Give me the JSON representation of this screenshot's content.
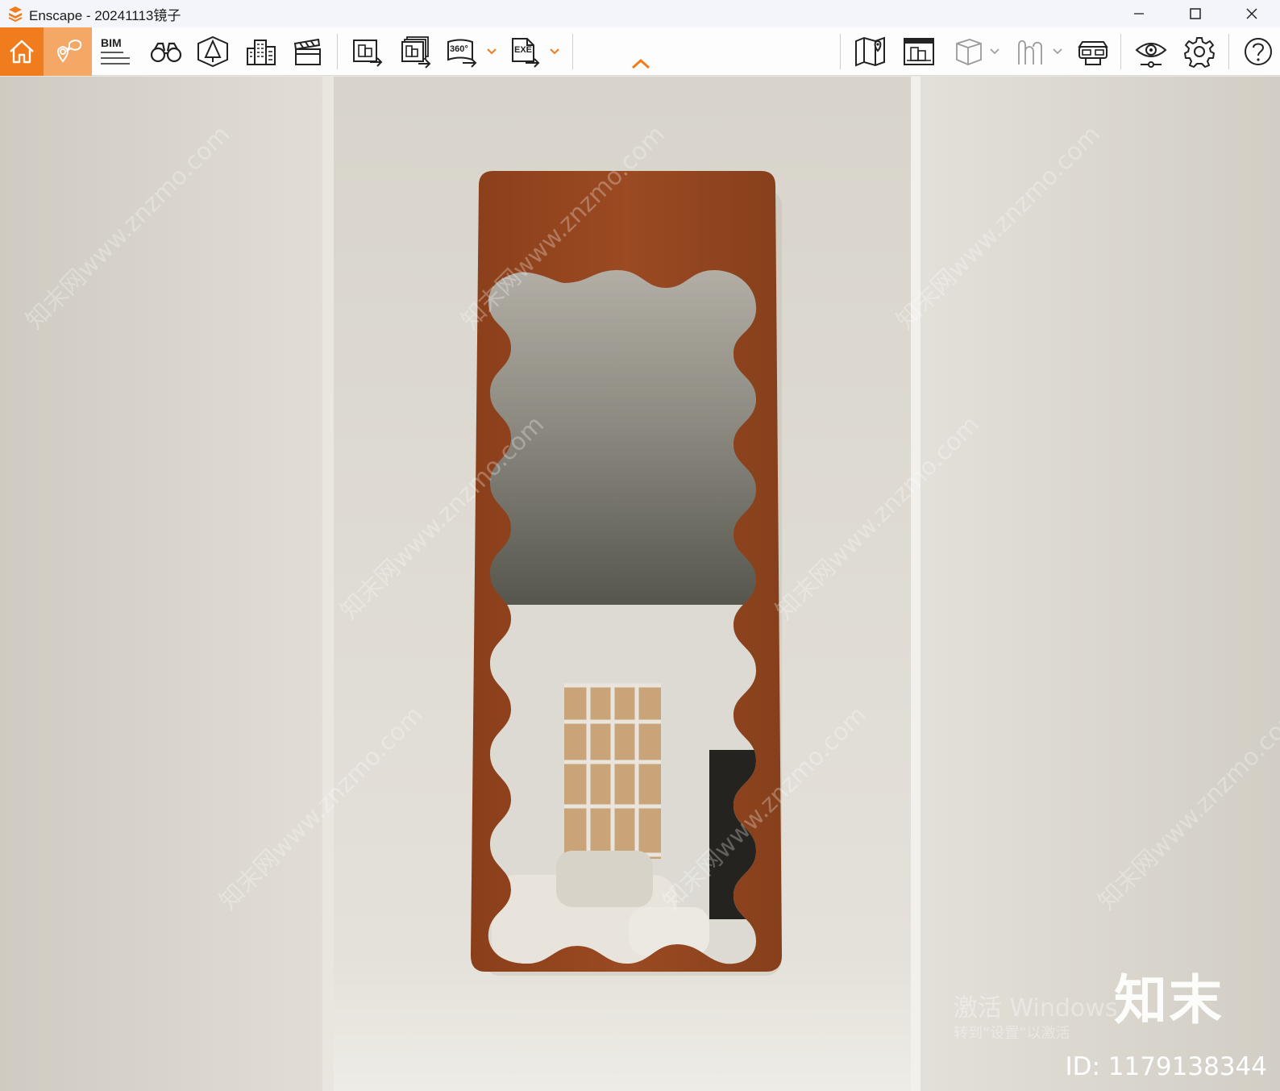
{
  "window": {
    "title": "Enscape - 20241113镜子",
    "controls": [
      "minimize-icon",
      "maximize-icon",
      "close-icon"
    ]
  },
  "toolbar": {
    "accent_color": "#f07c1e",
    "bim_label": "BIM",
    "pano_label": "360°",
    "exe_label": "EXE",
    "buttons": [
      "home-icon",
      "map-pin-icon",
      "bim-icon",
      "binoculars-icon",
      "perspective-icon",
      "buildings-icon",
      "clapperboard-icon",
      "screenshot-export-icon",
      "batch-export-icon",
      "panorama-360-icon",
      "exe-export-icon",
      "collapse-chevron-icon",
      "map-icon",
      "site-context-icon",
      "box-icon",
      "people-icon",
      "vr-headset-icon",
      "eye-icon",
      "settings-gear-icon",
      "help-icon"
    ]
  },
  "viewport": {
    "watermark": "知末网www.znzmo.com",
    "activation_title": "激活 Windows",
    "activation_sub": "转到“设置”以激活",
    "brand": "知末",
    "id_text": "ID: 1179138344"
  }
}
